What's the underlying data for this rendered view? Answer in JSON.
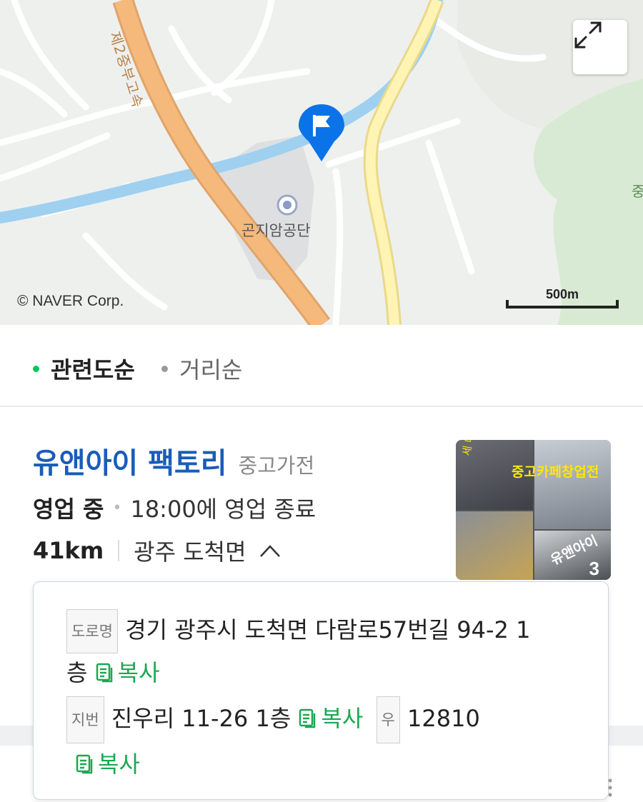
{
  "map": {
    "road_label": "제2중부고속",
    "place_label": "곤지암공단",
    "edge_label": "중",
    "copyright": "© NAVER Corp.",
    "scale": "500m",
    "expand_icon": "expand-icon",
    "pin_icon": "flag-pin-icon"
  },
  "sort": {
    "options": [
      {
        "label": "관련도순",
        "active": true
      },
      {
        "label": "거리순",
        "active": false
      }
    ]
  },
  "listing": {
    "name": "유앤아이 팩토리",
    "category": "중고가전",
    "status": "영업 중",
    "hours": "18:00에 영업 종료",
    "distance": "41km",
    "region": "광주 도척면",
    "thumbnail_count": "3",
    "thumbnail_captions": [
      "세 매입 전문",
      "중고카페창업전",
      "유앤아이"
    ]
  },
  "address_popup": {
    "road_tag": "도로명",
    "road_address_line1": "경기 광주시 도척면 다람로57번길 94-2 1",
    "road_address_line2": "층",
    "copy_label": "복사",
    "lot_tag": "지번",
    "lot_address": "진우리 11-26 1층",
    "postal_tag": "우",
    "postal_code": "12810"
  },
  "colors": {
    "link_blue": "#1a5cb8",
    "naver_green": "#03c75a",
    "copy_green": "#1aa851",
    "pin_blue": "#0a73e8",
    "river_blue": "#9fd0f0",
    "highway_orange": "#f4b97b"
  }
}
